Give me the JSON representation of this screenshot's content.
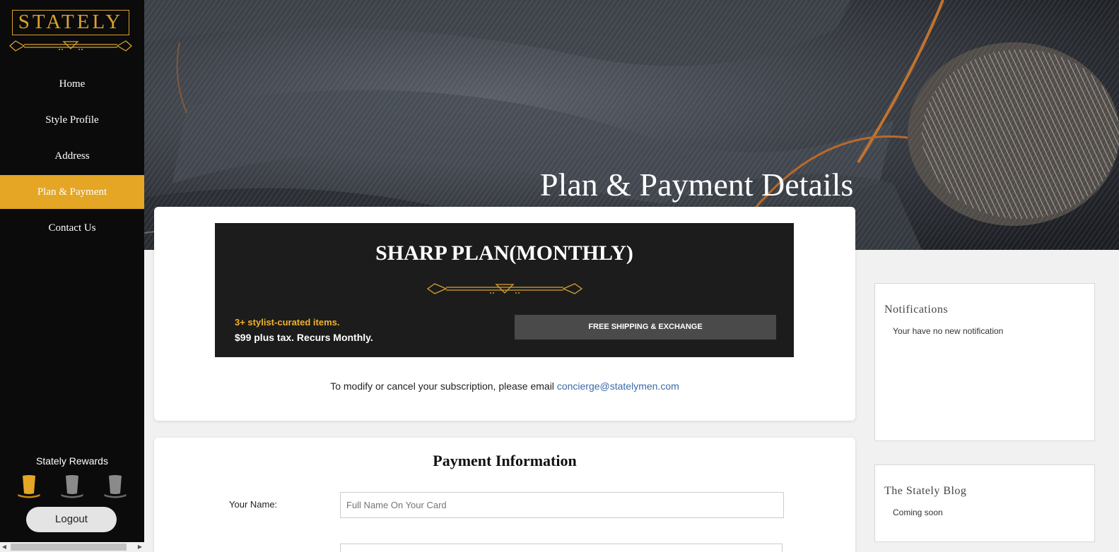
{
  "brand": {
    "name": "STATELY",
    "accent": "#e4a624"
  },
  "sidebar": {
    "items": [
      {
        "label": "Home"
      },
      {
        "label": "Style Profile"
      },
      {
        "label": "Address"
      },
      {
        "label": "Plan & Payment",
        "active": true
      },
      {
        "label": "Contact Us"
      }
    ],
    "rewards_label": "Stately Rewards",
    "rewards": {
      "earned": 1,
      "total": 3,
      "icon": "top-hat-icon"
    },
    "logout_label": "Logout"
  },
  "hero": {
    "title": "Plan & Payment Details"
  },
  "plan": {
    "title": "SHARP PLAN(MONTHLY)",
    "items_text": "3+ stylist-curated items.",
    "price_text": "$99 plus tax. Recurs Monthly.",
    "shipping_label": "FREE SHIPPING & EXCHANGE",
    "modify_text": "To modify or cancel your subscription, please email ",
    "email": "concierge@statelymen.com"
  },
  "payment": {
    "title": "Payment Information",
    "name_label": "Your Name:",
    "name_placeholder": "Full Name On Your Card"
  },
  "notifications": {
    "title": "Notifications",
    "text": "Your have no new notification"
  },
  "blog": {
    "title": "The Stately Blog",
    "text": "Coming soon"
  }
}
